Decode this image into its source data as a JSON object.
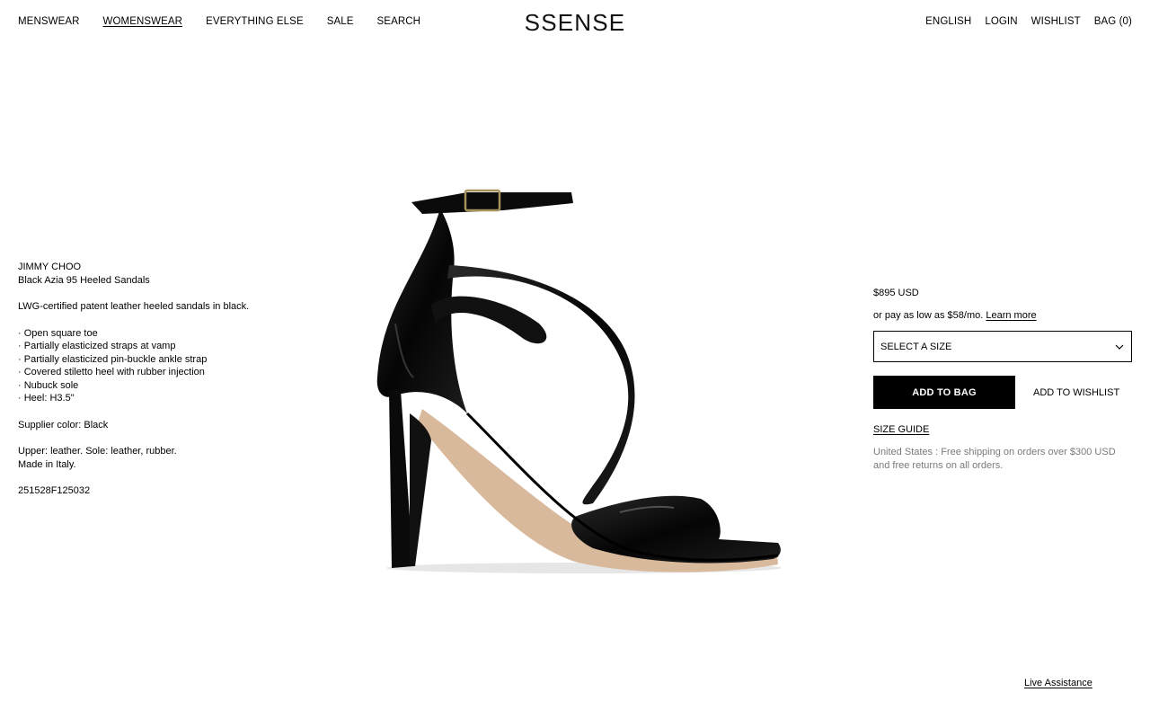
{
  "header": {
    "logo": "SSENSE",
    "nav_left": [
      {
        "label": "MENSWEAR",
        "active": false
      },
      {
        "label": "WOMENSWEAR",
        "active": true
      },
      {
        "label": "EVERYTHING ELSE",
        "active": false
      },
      {
        "label": "SALE",
        "active": false
      },
      {
        "label": "SEARCH",
        "active": false
      }
    ],
    "nav_right": [
      {
        "label": "ENGLISH"
      },
      {
        "label": "LOGIN"
      },
      {
        "label": "WISHLIST"
      },
      {
        "label": "BAG (0)"
      }
    ]
  },
  "product": {
    "brand": "JIMMY CHOO",
    "name": "Black Azia 95 Heeled Sandals",
    "summary": "LWG-certified patent leather heeled sandals in black.",
    "features": [
      "Open square toe",
      "Partially elasticized straps at vamp",
      "Partially elasticized pin-buckle ankle strap",
      "Covered stiletto heel with rubber injection",
      "Nubuck sole",
      "Heel: H3.5\""
    ],
    "supplier_color": "Supplier color: Black",
    "materials": "Upper: leather. Sole: leather, rubber.",
    "origin": "Made in Italy.",
    "sku": "251528F125032",
    "image_icon": "heeled-sandal-image"
  },
  "purchase": {
    "price": "$895 USD",
    "installments_text": "or pay as low as $58/mo.",
    "learn_more": "Learn more",
    "size_select_placeholder": "SELECT A SIZE",
    "add_to_bag": "ADD TO BAG",
    "add_to_wishlist": "ADD TO WISHLIST",
    "size_guide": "SIZE GUIDE",
    "shipping_note": "United States : Free shipping on orders over $300 USD and free returns on all orders."
  },
  "support": {
    "live_assistance": "Live Assistance"
  },
  "colors": {
    "text": "#000000",
    "muted": "#7a7a7a",
    "button_bg": "#000000",
    "button_text": "#ffffff",
    "background": "#ffffff"
  }
}
